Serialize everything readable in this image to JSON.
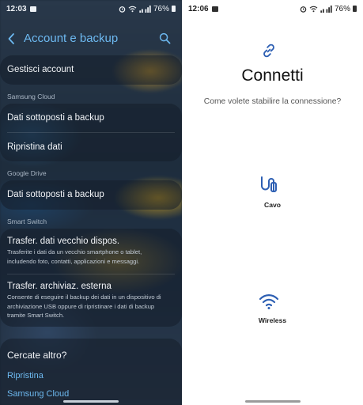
{
  "left": {
    "status": {
      "time": "12:03",
      "battery": "76%"
    },
    "header": {
      "title": "Account e backup"
    },
    "items": {
      "manage": "Gestisci account",
      "samsung_cloud_section": "Samsung Cloud",
      "backed_up_data": "Dati sottoposti a backup",
      "restore_data": "Ripristina dati",
      "google_drive_section": "Google Drive",
      "google_backed_up": "Dati sottoposti a backup",
      "smart_switch_section": "Smart Switch",
      "transfer_old_title": "Trasfer. dati vecchio dispos.",
      "transfer_old_desc": "Trasferite i dati da un vecchio smartphone o tablet, includendo foto, contatti, applicazioni e messaggi.",
      "transfer_ext_title": "Trasfer. archiviaz. esterna",
      "transfer_ext_desc": "Consente di eseguire il backup dei dati in un dispositivo di archiviazione USB oppure di ripristinare i dati di backup tramite Smart Switch."
    },
    "looking": {
      "title": "Cercate altro?",
      "link1": "Ripristina",
      "link2": "Samsung Cloud"
    },
    "colors": {
      "accent": "#6db9f0"
    }
  },
  "right": {
    "status": {
      "time": "12:06",
      "battery": "76%"
    },
    "title": "Connetti",
    "subtitle": "Come volete stabilire la connessione?",
    "options": [
      {
        "label": "Cavo",
        "icon": "cable-icon"
      },
      {
        "label": "Wireless",
        "icon": "wifi-icon"
      }
    ],
    "colors": {
      "accent": "#2d5fb3"
    }
  }
}
